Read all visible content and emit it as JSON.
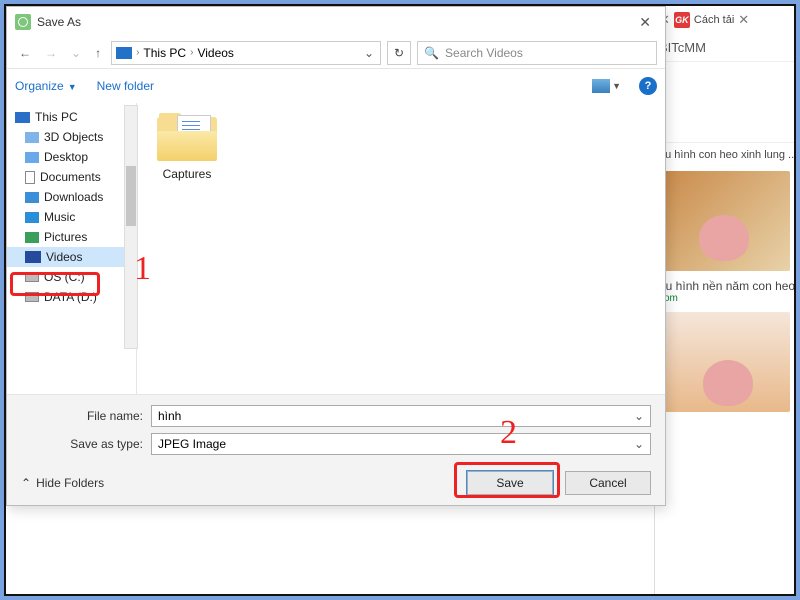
{
  "dialog": {
    "title": "Save As",
    "close_glyph": "✕",
    "nav": {
      "path_root": "This PC",
      "path_current": "Videos",
      "chevron": "›",
      "dropdown_glyph": "⌄",
      "refresh_glyph": "↻",
      "search_placeholder": "Search Videos"
    },
    "toolbar": {
      "organize": "Organize",
      "new_folder": "New folder",
      "help_glyph": "?"
    },
    "tree": [
      {
        "label": "This PC",
        "icon": "this-pc",
        "indent": 0
      },
      {
        "label": "3D Objects",
        "icon": "cube",
        "indent": 1
      },
      {
        "label": "Desktop",
        "icon": "desk",
        "indent": 1
      },
      {
        "label": "Documents",
        "icon": "doc",
        "indent": 1
      },
      {
        "label": "Downloads",
        "icon": "dl",
        "indent": 1
      },
      {
        "label": "Music",
        "icon": "music",
        "indent": 1
      },
      {
        "label": "Pictures",
        "icon": "pics",
        "indent": 1
      },
      {
        "label": "Videos",
        "icon": "vid",
        "indent": 1,
        "selected": true
      },
      {
        "label": "OS (C:)",
        "icon": "disk",
        "indent": 1
      },
      {
        "label": "DATA (D:)",
        "icon": "disk",
        "indent": 1
      }
    ],
    "content": {
      "folder_label": "Captures"
    },
    "form": {
      "filename_label": "File name:",
      "filename_value": "hình",
      "type_label": "Save as type:",
      "type_value": "JPEG Image",
      "hide_folders": "Hide Folders",
      "hide_chevron": "⌃",
      "save": "Save",
      "cancel": "Cancel"
    }
  },
  "browser": {
    "tab_close": "✕",
    "tab2_label": "Cách tải",
    "url_fragment": "BITcMM",
    "result1": "hu hình con heo xinh lung ...",
    "result2_title": "ầu hình nền năm con heo ...",
    "result2_domain": "com"
  },
  "annotation": {
    "num1": "1",
    "num2": "2"
  }
}
